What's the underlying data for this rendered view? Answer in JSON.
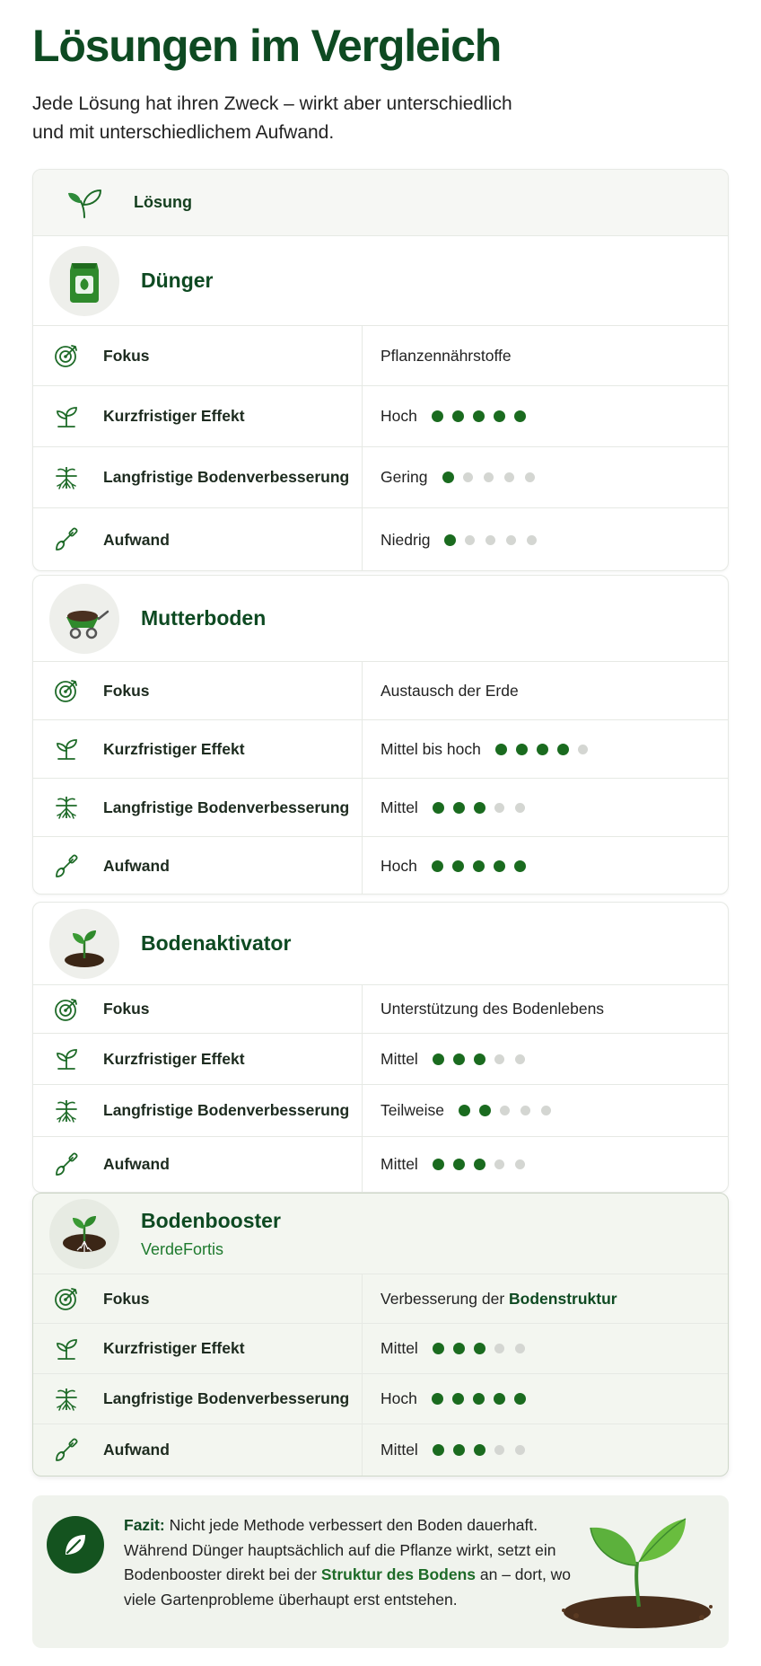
{
  "title": "Lösungen im Vergleich",
  "intro": "Jede Lösung hat ihren Zweck – wirkt aber unterschiedlich und mit unterschiedlichem Aufwand.",
  "table_header": {
    "label": "Lösung",
    "icon": "sprout-icon"
  },
  "row_labels": {
    "focus": "Fokus",
    "short_term": "Kurzfristiger Effekt",
    "long_term": "Langfristige Bodenverbesserung",
    "effort": "Aufwand"
  },
  "solutions": [
    {
      "name": "Dünger",
      "image": "fertilizer-bag-icon",
      "focus": "Pflanzennährstoffe",
      "short_term": {
        "text": "Hoch",
        "rating": 5
      },
      "long_term": {
        "text": "Gering",
        "rating": 1
      },
      "effort": {
        "text": "Niedrig",
        "rating": 1
      }
    },
    {
      "name": "Mutterboden",
      "image": "wheelbarrow-icon",
      "focus": "Austausch der Erde",
      "short_term": {
        "text": "Mittel bis hoch",
        "rating": 4
      },
      "long_term": {
        "text": "Mittel",
        "rating": 3
      },
      "effort": {
        "text": "Hoch",
        "rating": 5
      }
    },
    {
      "name": "Bodenaktivator",
      "image": "seedling-soil-icon",
      "focus": "Unterstützung des Bodenlebens",
      "short_term": {
        "text": "Mittel",
        "rating": 3
      },
      "long_term": {
        "text": "Teilweise",
        "rating": 2
      },
      "effort": {
        "text": "Mittel",
        "rating": 3
      }
    },
    {
      "name": "Bodenbooster",
      "brand": "VerdeFortis",
      "image": "seedling-roots-icon",
      "focus_prefix": "Verbesserung der ",
      "focus_bold": "Bodenstruktur",
      "short_term": {
        "text": "Mittel",
        "rating": 3
      },
      "long_term": {
        "text": "Hoch",
        "rating": 5
      },
      "effort": {
        "text": "Mittel",
        "rating": 3
      }
    }
  ],
  "rating_max": 5,
  "fazit": {
    "label": "Fazit:",
    "text_1": " Nicht jede Methode verbessert den Boden dauerhaft. Während Dünger hauptsächlich auf die Pflanze wirkt, setzt ein Bodenbooster direkt bei der ",
    "highlight": "Struktur des Bodens",
    "text_2": " an – dort, wo viele Gartenprobleme überhaupt erst entstehen."
  },
  "colors": {
    "primary": "#0e4a22",
    "dot_on": "#1a6b1f",
    "dot_off": "#d4d6d2"
  }
}
